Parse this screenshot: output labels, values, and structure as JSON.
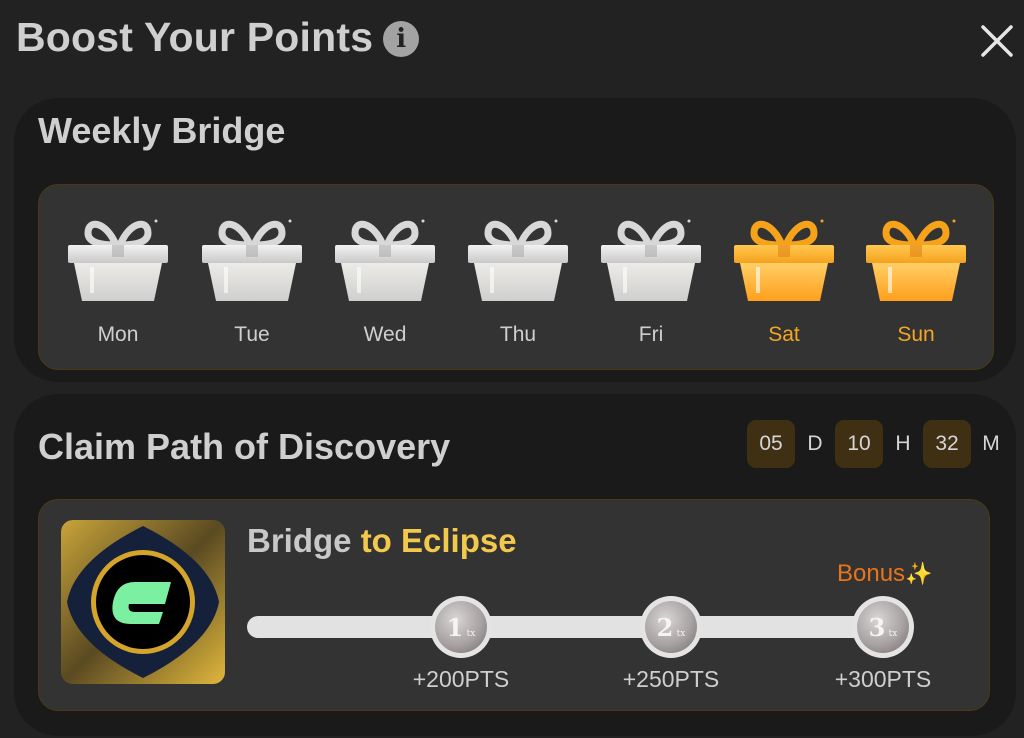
{
  "header": {
    "title": "Boost Your Points",
    "info_icon": "info-circle-icon",
    "close_icon": "close-x-icon"
  },
  "weekly_bridge": {
    "title": "Weekly Bridge",
    "days": [
      {
        "label": "Mon",
        "state": "claimed",
        "icon": "gift-box-silver-icon"
      },
      {
        "label": "Tue",
        "state": "claimed",
        "icon": "gift-box-silver-icon"
      },
      {
        "label": "Wed",
        "state": "claimed",
        "icon": "gift-box-silver-icon"
      },
      {
        "label": "Thu",
        "state": "claimed",
        "icon": "gift-box-silver-icon"
      },
      {
        "label": "Fri",
        "state": "claimed",
        "icon": "gift-box-silver-icon"
      },
      {
        "label": "Sat",
        "state": "bonus",
        "icon": "gift-box-gold-icon"
      },
      {
        "label": "Sun",
        "state": "bonus",
        "icon": "gift-box-gold-icon"
      }
    ]
  },
  "discovery": {
    "title": "Claim Path of Discovery",
    "countdown": {
      "days": "05",
      "days_unit": "D",
      "hours": "10",
      "hours_unit": "H",
      "minutes": "32",
      "minutes_unit": "M"
    },
    "task": {
      "logo": "eclipse-logo-icon",
      "title_part1": "Bridge",
      "title_part2": "to Eclipse",
      "bonus_label": "Bonus",
      "bonus_icon": "sparkle-icon",
      "milestones": [
        {
          "number": "1",
          "suffix": "tx",
          "reward": "+200PTS"
        },
        {
          "number": "2",
          "suffix": "tx",
          "reward": "+250PTS"
        },
        {
          "number": "3",
          "suffix": "tx",
          "reward": "+300PTS"
        }
      ]
    }
  },
  "colors": {
    "accent_gold": "#f2c94c",
    "bonus_orange": "#e8741c",
    "day_bonus": "#f5a623",
    "eclipse_green": "#7bf0a0"
  }
}
